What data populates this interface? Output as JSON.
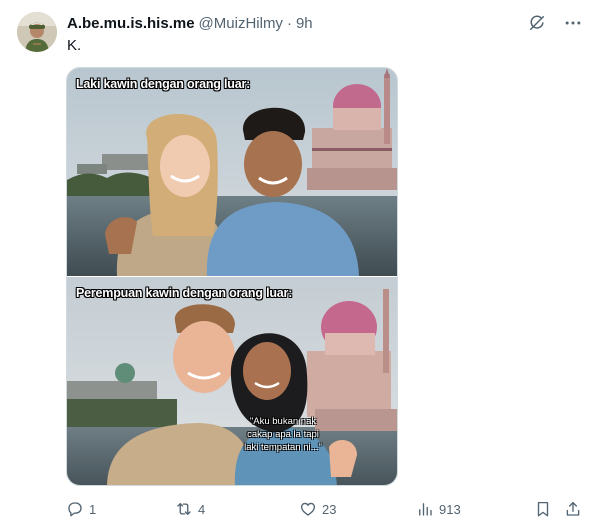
{
  "author": {
    "display_name": "A.be.mu.is.his.me",
    "handle": "@MuizHilmy",
    "separator": "·",
    "time": "9h"
  },
  "tweet": {
    "text": "K."
  },
  "media": {
    "top_caption": "Laki kawin dengan orang luar:",
    "bottom_caption": "Perempuan kawin dengan orang luar:",
    "quote_line1": "\"Aku bukan nak",
    "quote_line2": "cakap apa la tapi",
    "quote_line3": "laki tempatan ni...\""
  },
  "actions": {
    "replies": "1",
    "reposts": "4",
    "likes": "23",
    "views": "913"
  },
  "icons": {
    "grok": "grok-icon",
    "more": "more-icon",
    "reply": "reply-icon",
    "repost": "repost-icon",
    "like": "like-icon",
    "views": "views-icon",
    "bookmark": "bookmark-icon",
    "share": "share-icon"
  },
  "colors": {
    "text_primary": "#0f1419",
    "text_secondary": "#536471",
    "border": "#cfd9de"
  }
}
